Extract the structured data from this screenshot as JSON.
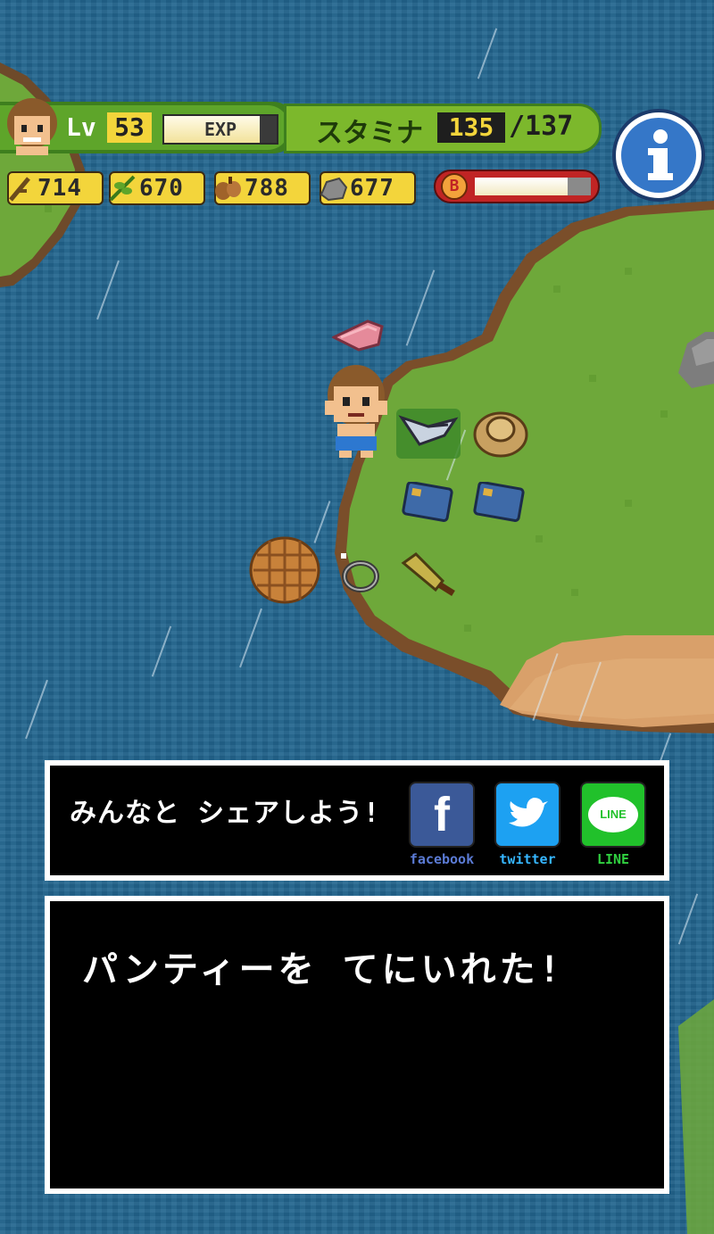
{
  "hud": {
    "level_prefix": "Lv",
    "level": "53",
    "exp_label": "EXP",
    "exp_fill": 0.85,
    "stamina_label": "スタミナ",
    "stamina_current": "135",
    "stamina_max": "/137",
    "resources": [
      {
        "icon": "branch-icon",
        "value": "714"
      },
      {
        "icon": "leaf-icon",
        "value": "670"
      },
      {
        "icon": "nut-icon",
        "value": "788"
      },
      {
        "icon": "stone-icon",
        "value": "677"
      }
    ],
    "bonus_badge": "B",
    "bonus_fill": 0.8
  },
  "share": {
    "text": "みんなと シェアしよう!",
    "buttons": [
      {
        "name": "facebook",
        "glyph": "f",
        "caption": "facebook",
        "color": "#3b5998",
        "caption_color": "#5b7bd5"
      },
      {
        "name": "twitter",
        "glyph": "🐦",
        "caption": "twitter",
        "color": "#1da1f2",
        "caption_color": "#36b6ff"
      },
      {
        "name": "line",
        "glyph": "LINE",
        "caption": "LINE",
        "color": "#21c12b",
        "caption_color": "#30d040"
      }
    ]
  },
  "message": {
    "text": "パンティーを てにいれた!"
  },
  "colors": {
    "ocean": "#23668f",
    "grass": "#6ea83a",
    "sand": "#d9a06a",
    "hud_green": "#5ea52a",
    "hud_yellow": "#f3d53b"
  }
}
